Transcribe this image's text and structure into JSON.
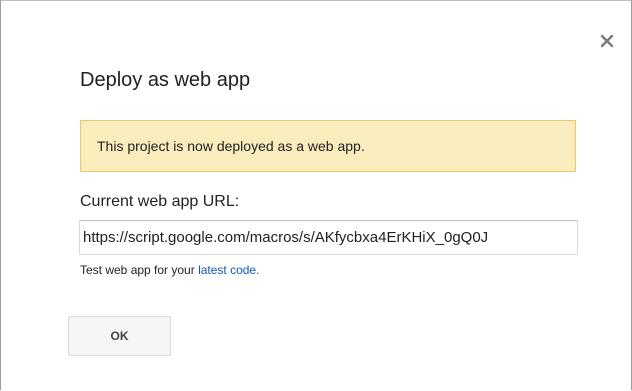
{
  "dialog": {
    "title": "Deploy as web app",
    "close_icon": "close-icon",
    "notice": "This project is now deployed as a web app.",
    "url_label": "Current web app URL:",
    "url_value": "https://script.google.com/macros/s/AKfycbxa4ErKHiX_0gQ0J",
    "hint_prefix": "Test web app for your ",
    "hint_link": "latest code.",
    "ok_label": "OK"
  },
  "colors": {
    "notice_background": "#f9edbe",
    "notice_border": "#f0c36d",
    "link": "#1155cc",
    "button_background": "#f5f5f5"
  }
}
